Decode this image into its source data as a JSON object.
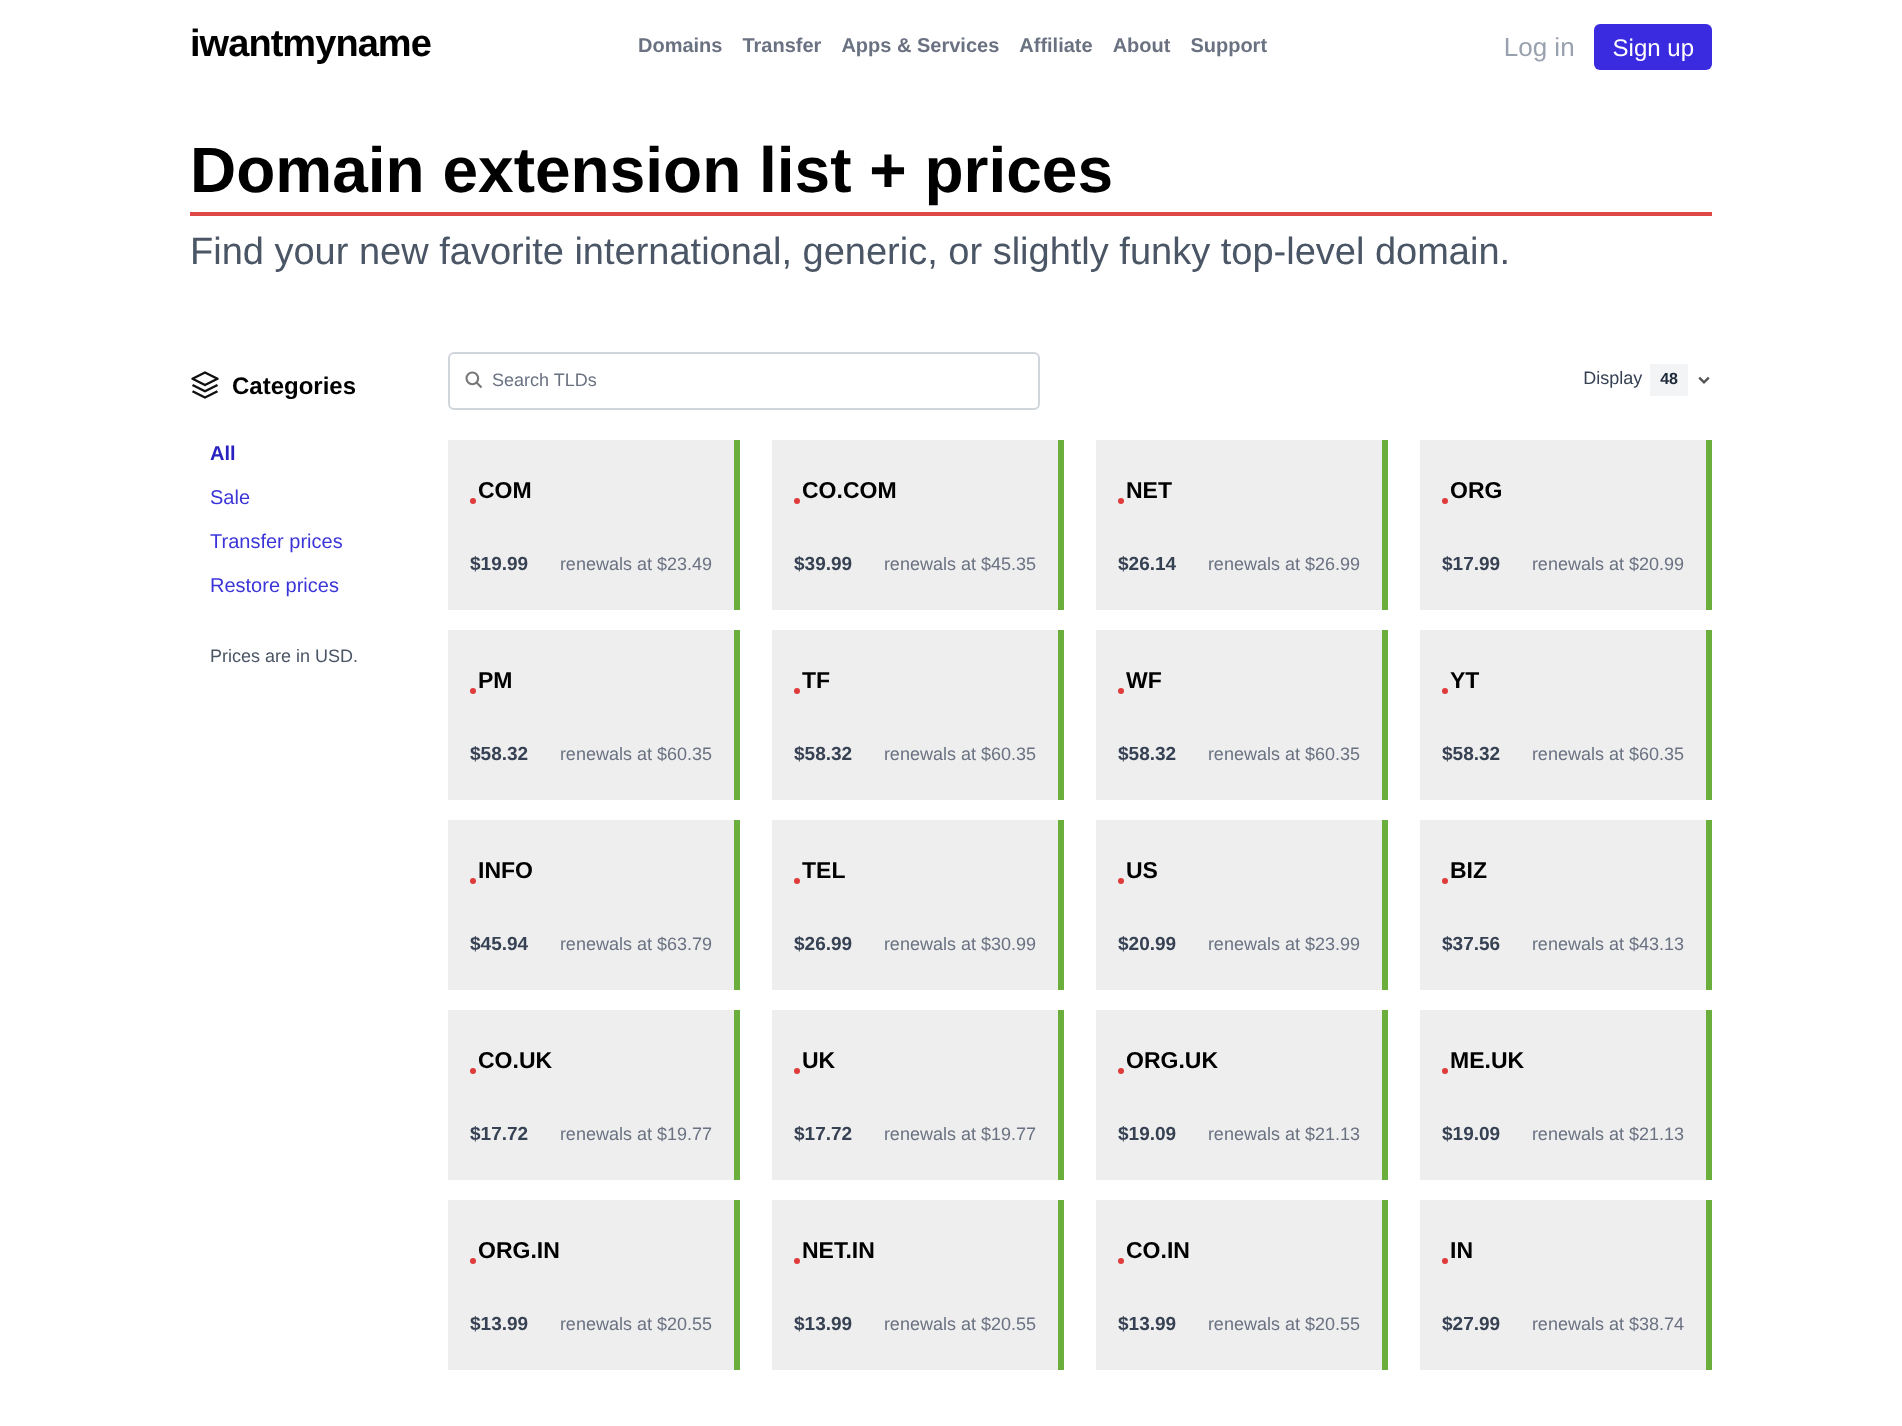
{
  "header": {
    "logo": "iwantmyname",
    "nav": [
      "Domains",
      "Transfer",
      "Apps & Services",
      "Affiliate",
      "About",
      "Support"
    ],
    "login": "Log in",
    "signup": "Sign up"
  },
  "title": "Domain extension list + prices",
  "subtitle": "Find your new favorite international, generic, or slightly funky top-level domain.",
  "sidebar": {
    "heading": "Categories",
    "items": [
      {
        "label": "All",
        "selected": true
      },
      {
        "label": "Sale",
        "selected": false
      },
      {
        "label": "Transfer prices",
        "selected": false
      },
      {
        "label": "Restore prices",
        "selected": false
      }
    ],
    "note": "Prices are in USD."
  },
  "search": {
    "placeholder": "Search TLDs"
  },
  "display": {
    "label": "Display",
    "value": "48"
  },
  "cards": [
    {
      "name": "COM",
      "price": "$19.99",
      "renewal": "renewals at $23.49"
    },
    {
      "name": "CO.COM",
      "price": "$39.99",
      "renewal": "renewals at $45.35"
    },
    {
      "name": "NET",
      "price": "$26.14",
      "renewal": "renewals at $26.99"
    },
    {
      "name": "ORG",
      "price": "$17.99",
      "renewal": "renewals at $20.99"
    },
    {
      "name": "PM",
      "price": "$58.32",
      "renewal": "renewals at $60.35"
    },
    {
      "name": "TF",
      "price": "$58.32",
      "renewal": "renewals at $60.35"
    },
    {
      "name": "WF",
      "price": "$58.32",
      "renewal": "renewals at $60.35"
    },
    {
      "name": "YT",
      "price": "$58.32",
      "renewal": "renewals at $60.35"
    },
    {
      "name": "INFO",
      "price": "$45.94",
      "renewal": "renewals at $63.79"
    },
    {
      "name": "TEL",
      "price": "$26.99",
      "renewal": "renewals at $30.99"
    },
    {
      "name": "US",
      "price": "$20.99",
      "renewal": "renewals at $23.99"
    },
    {
      "name": "BIZ",
      "price": "$37.56",
      "renewal": "renewals at $43.13"
    },
    {
      "name": "CO.UK",
      "price": "$17.72",
      "renewal": "renewals at $19.77"
    },
    {
      "name": "UK",
      "price": "$17.72",
      "renewal": "renewals at $19.77"
    },
    {
      "name": "ORG.UK",
      "price": "$19.09",
      "renewal": "renewals at $21.13"
    },
    {
      "name": "ME.UK",
      "price": "$19.09",
      "renewal": "renewals at $21.13"
    },
    {
      "name": "ORG.IN",
      "price": "$13.99",
      "renewal": "renewals at $20.55"
    },
    {
      "name": "NET.IN",
      "price": "$13.99",
      "renewal": "renewals at $20.55"
    },
    {
      "name": "CO.IN",
      "price": "$13.99",
      "renewal": "renewals at $20.55"
    },
    {
      "name": "IN",
      "price": "$27.99",
      "renewal": "renewals at $38.74"
    }
  ]
}
